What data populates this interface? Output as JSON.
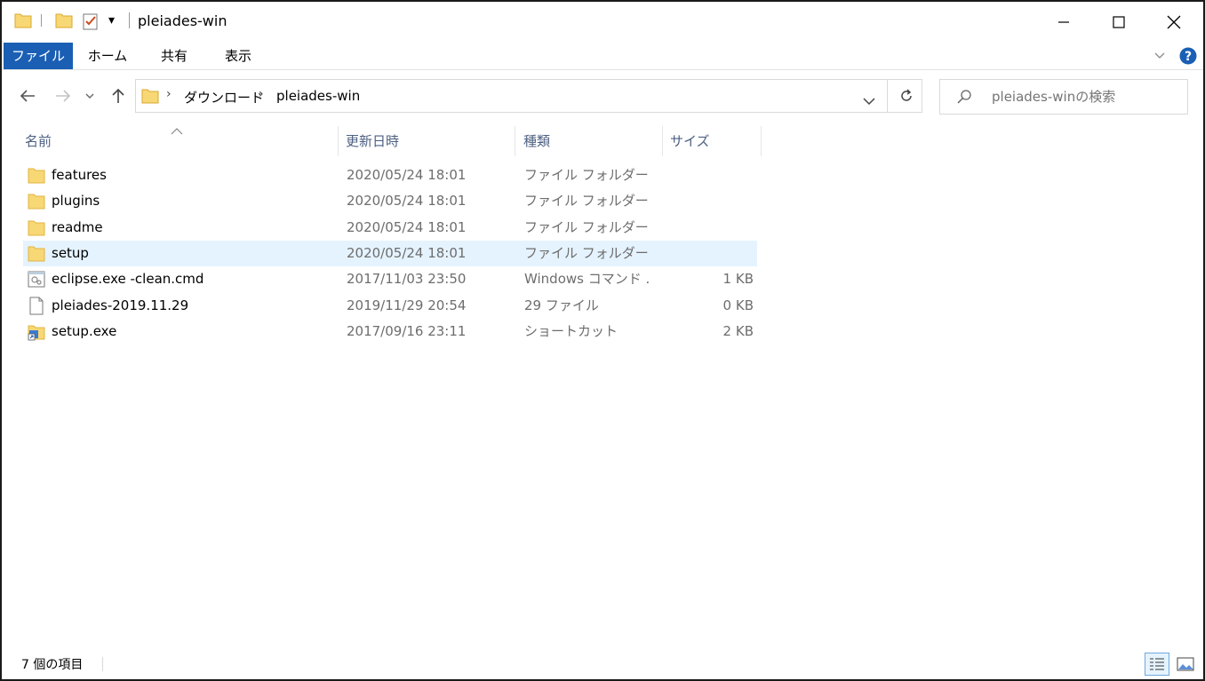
{
  "window": {
    "title": "pleiades-win",
    "quick_access_dropdown": "▾"
  },
  "ribbon": {
    "tabs": [
      {
        "label": "ファイル",
        "active": true
      },
      {
        "label": "ホーム",
        "active": false
      },
      {
        "label": "共有",
        "active": false
      },
      {
        "label": "表示",
        "active": false
      }
    ]
  },
  "address_bar": {
    "breadcrumbs": [
      "ダウンロード",
      "pleiades-win"
    ]
  },
  "search": {
    "placeholder": "pleiades-winの検索"
  },
  "columns": {
    "name": "名前",
    "date": "更新日時",
    "type": "種類",
    "size": "サイズ"
  },
  "files": [
    {
      "name": "features",
      "date": "2020/05/24 18:01",
      "type": "ファイル フォルダー",
      "size": "",
      "icon": "folder-icon",
      "selected": false
    },
    {
      "name": "plugins",
      "date": "2020/05/24 18:01",
      "type": "ファイル フォルダー",
      "size": "",
      "icon": "folder-icon",
      "selected": false
    },
    {
      "name": "readme",
      "date": "2020/05/24 18:01",
      "type": "ファイル フォルダー",
      "size": "",
      "icon": "folder-icon",
      "selected": false
    },
    {
      "name": "setup",
      "date": "2020/05/24 18:01",
      "type": "ファイル フォルダー",
      "size": "",
      "icon": "folder-icon",
      "selected": true
    },
    {
      "name": "eclipse.exe -clean.cmd",
      "date": "2017/11/03 23:50",
      "type": "Windows コマンド ...",
      "size": "1 KB",
      "icon": "cmd-file-icon",
      "selected": false
    },
    {
      "name": "pleiades-2019.11.29",
      "date": "2019/11/29 20:54",
      "type": "29 ファイル",
      "size": "0 KB",
      "icon": "blank-file-icon",
      "selected": false
    },
    {
      "name": "setup.exe",
      "date": "2017/09/16 23:11",
      "type": "ショートカット",
      "size": "2 KB",
      "icon": "shortcut-icon",
      "selected": false
    }
  ],
  "status_bar": {
    "item_count": "7 個の項目"
  },
  "colors": {
    "accent": "#1a5fb4",
    "selection": "#e5f3ff",
    "folder": "#f8d775",
    "header_text": "#4d6082"
  }
}
